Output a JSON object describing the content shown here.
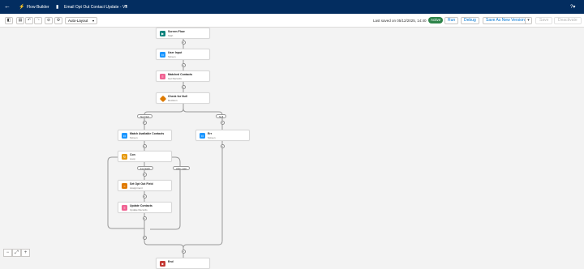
{
  "header": {
    "back_icon": "back-arrow-icon",
    "app_name": "Flow Builder",
    "flow_title": "Email Opt Out Contact Update - V3",
    "help_label": "?"
  },
  "toolbar": {
    "layout_value": "Auto-Layout",
    "last_saved": "Last saved on 05/12/2025, 14:40",
    "status_badge": "Active",
    "run_label": "Run",
    "debug_label": "Debug",
    "save_new_version_label": "Save As New Version",
    "save_label": "Save",
    "deactivate_label": "Deactivate"
  },
  "flow": {
    "nodes": {
      "start": {
        "label": "Screen Flow",
        "type": "Start"
      },
      "user_input": {
        "label": "User Input",
        "type": "Screen"
      },
      "matched_contacts": {
        "label": "Matched Contacts",
        "type": "Get Records"
      },
      "check_null": {
        "label": "Check for Null",
        "type": "Decision"
      },
      "match_available": {
        "label": "Match Available Contacts",
        "type": "Screen"
      },
      "err": {
        "label": "Err",
        "type": "Screen"
      },
      "con": {
        "label": "Con",
        "type": "Loop"
      },
      "set_opt_out": {
        "label": "Set Opt Out Field",
        "type": "Assignment"
      },
      "update_contacts": {
        "label": "Update Contacts",
        "type": "Update Records"
      },
      "end": {
        "label": "End",
        "type": ""
      }
    },
    "branches": {
      "not_null": "Not Null",
      "null": "Null",
      "for_each": "For Each",
      "after_last": "After Last"
    }
  },
  "colors": {
    "header_bg": "#032d60",
    "screen": "#1b96ff",
    "start": "#0b827c",
    "get_records": "#f06292",
    "decision": "#dd7a01",
    "loop": "#e69a10",
    "assignment": "#e07a00",
    "end": "#c23934",
    "active": "#2e844a"
  }
}
